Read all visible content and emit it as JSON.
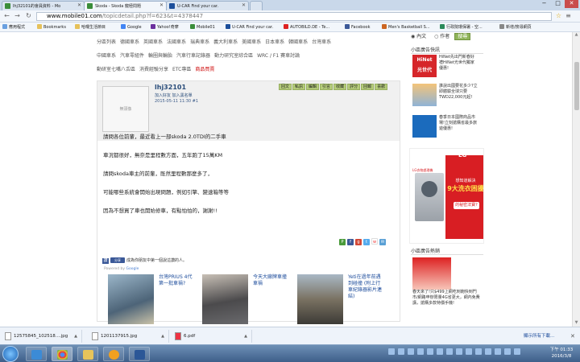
{
  "browser": {
    "tabs": [
      {
        "label": "lhj32101的會員資料 - Mo",
        "icon": "mobile01-favicon"
      },
      {
        "label": "Skoda - Skoda 龍極問題",
        "icon": "mobile01-favicon"
      },
      {
        "label": "U-CAR Find your car.",
        "icon": "ucar-favicon"
      }
    ],
    "window_controls": [
      "−",
      "□",
      "✕"
    ],
    "url_domain": "www.mobile01.com",
    "url_path": "/topicdetail.php?f=623&t=4378447",
    "bookmarks": [
      "應用程式",
      "Bookmarks",
      "哈囉生活節目",
      "Google",
      "Yahoo!奇摩",
      "Mobile01",
      "U-CAR Find your car.",
      "AUTOBILD.DE - Te...",
      "Facebook",
      "Men's Basketball S...",
      "行政院環保署 - 空...",
      "新增/搜尋網頁"
    ]
  },
  "categories": {
    "row1": [
      "分區列表",
      "德國車系",
      "英國車系",
      "法國車系",
      "瑞典車系",
      "義大利車系",
      "美國車系",
      "日本車系",
      "韓國車系",
      "台灣車系"
    ],
    "row2": [
      "中國車系",
      "汽車零組件",
      "輪圈與輪胎",
      "汽車行車記錄器",
      "動力研究室綜合區",
      "WRC / F1 賽車討論"
    ],
    "row3": [
      "動研室七嘴八舌區",
      "消費經驗分享",
      "ETC專區",
      "商品買賣"
    ]
  },
  "post": {
    "avatar_text": "無頭像",
    "username": "lhj32101",
    "user_links": [
      "加入好友",
      "加入黑名單"
    ],
    "date": "2015-05-11 11:30",
    "floor": "#1",
    "actions": [
      "回文",
      "私訊",
      "編輯",
      "引言",
      "收藏",
      "評分",
      "回報",
      "喜歡"
    ],
    "lines": [
      "請問各位前輩，最近看上一部skoda 2.0TDI的二手車",
      "車況都很好，無奈是里程數方面，五年跑了15萬KM",
      "請問skoda車主的前輩，既然里程數那麼多了，",
      "可能哪些系統會開始出現問題，例如引擎、變速箱等等",
      "因為不想買了車也開始修車，有點怕怕的，謝謝!!"
    ],
    "share_icons": [
      "plurk-icon",
      "facebook-icon",
      "googleplus-icon",
      "twitter-icon",
      "weibo-icon",
      "email-icon"
    ],
    "fb_like_label": "讚",
    "fb_share_label": "分享",
    "fb_prompt": "成為你朋友中第一個說這讚的人。",
    "powered_prefix": "Powered by",
    "powered_brand": "Google"
  },
  "related": [
    {
      "title": "台灣PRIUS 4代第一批車禍?"
    },
    {
      "title": "今天大廠牌車撞車禍"
    },
    {
      "title": "Yeti在過年前遇到碰撞 (附上行車紀錄器影片連結)"
    }
  ],
  "sidebar": {
    "search_options": [
      "內文",
      "作者"
    ],
    "search_button": "搜尋",
    "section1_title": "小區廣告快訊",
    "ads": [
      {
        "text": "HiNet先出門新春好禮HiNet光世代獨家優惠!"
      },
      {
        "text": "誰說出國要花多少?立即體驗全球只要TWD22,000元起!"
      },
      {
        "text": "春季日本國際商品市場!立刻搶購省最多旅遊優惠!"
      }
    ],
    "lg": {
      "logo": "LG",
      "line1": "想知道解決",
      "line2": "9大洗衣困擾",
      "cta": "的秘密法寶?",
      "tag": "LG衣物處理機"
    },
    "section2_title": "小區廣告熱銷",
    "promo": {
      "text": "春天來了!只$499上網吃到飽快到門市/網路申辦限量4G省更大，網內免費講，搶購多款特價手機!"
    }
  },
  "downloads": [
    {
      "name": "12575845_102518....jpg"
    },
    {
      "name": "1201137915.jpg"
    },
    {
      "name": "6.pdf"
    }
  ],
  "download_all": "顯示所有下載...",
  "download_close": "✕",
  "clock": {
    "time": "下午 01:33",
    "date": "2016/3/8"
  }
}
